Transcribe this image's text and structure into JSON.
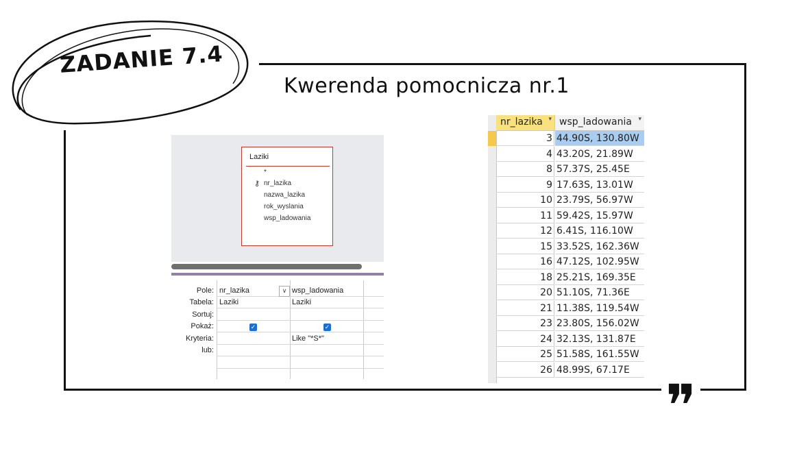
{
  "badge": "ZADANIE 7.4",
  "title": "Kwerenda pomocnicza nr.1",
  "quote_mark": "❞",
  "designer": {
    "table_name": "Laziki",
    "fields": [
      "*",
      "nr_lazika",
      "nazwa_lazika",
      "rok_wyslania",
      "wsp_ladowania"
    ],
    "row_labels": {
      "pole": "Pole:",
      "tabela": "Tabela:",
      "sortuj": "Sortuj:",
      "pokaz": "Pokaż:",
      "kryteria": "Kryteria:",
      "lub": "lub:"
    },
    "columns": [
      {
        "pole": "nr_lazika",
        "tabela": "Laziki",
        "pokaz": true,
        "kryteria": ""
      },
      {
        "pole": "wsp_ladowania",
        "tabela": "Laziki",
        "pokaz": true,
        "kryteria": "Like \"*S*\""
      }
    ]
  },
  "datasheet": {
    "headers": [
      "nr_lazika",
      "wsp_ladowania"
    ],
    "rows": [
      [
        "3",
        "44.90S, 130.80W"
      ],
      [
        "4",
        "43.20S, 21.89W"
      ],
      [
        "8",
        "57.37S, 25.45E"
      ],
      [
        "9",
        "17.63S, 13.01W"
      ],
      [
        "10",
        "23.79S, 56.97W"
      ],
      [
        "11",
        "59.42S, 15.97W"
      ],
      [
        "12",
        "6.41S, 116.10W"
      ],
      [
        "15",
        "33.52S, 162.36W"
      ],
      [
        "16",
        "47.12S, 102.95W"
      ],
      [
        "18",
        "25.21S, 169.35E"
      ],
      [
        "20",
        "51.10S, 71.36E"
      ],
      [
        "21",
        "11.38S, 119.54W"
      ],
      [
        "23",
        "23.80S, 156.02W"
      ],
      [
        "24",
        "32.13S, 131.87E"
      ],
      [
        "25",
        "51.58S, 161.55W"
      ],
      [
        "26",
        "48.99S, 67.17E"
      ]
    ]
  }
}
